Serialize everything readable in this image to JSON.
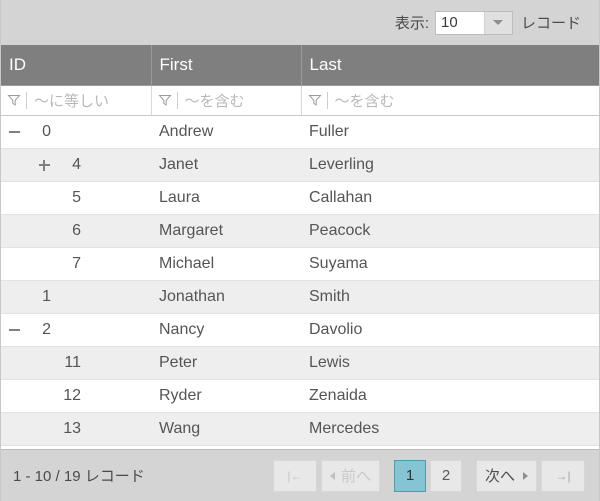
{
  "toolbar": {
    "label_prefix": "表示:",
    "page_size_value": "10",
    "label_suffix": "レコード",
    "dropdown_icon": "chevron-down-icon"
  },
  "table": {
    "columns": [
      {
        "key": "id",
        "label": "ID",
        "filter_placeholder": "〜に等しい",
        "filter_icon": "filter-funnel-icon"
      },
      {
        "key": "first",
        "label": "First",
        "filter_placeholder": "〜を含む",
        "filter_icon": "filter-funnel-icon"
      },
      {
        "key": "last",
        "label": "Last",
        "filter_placeholder": "〜を含む",
        "filter_icon": "filter-funnel-icon"
      }
    ],
    "rows": [
      {
        "id": "0",
        "first": "Andrew",
        "last": "Fuller",
        "level": 0,
        "toggle": "minus"
      },
      {
        "id": "4",
        "first": "Janet",
        "last": "Leverling",
        "level": 1,
        "toggle": "plus"
      },
      {
        "id": "5",
        "first": "Laura",
        "last": "Callahan",
        "level": 1,
        "toggle": "none"
      },
      {
        "id": "6",
        "first": "Margaret",
        "last": "Peacock",
        "level": 1,
        "toggle": "none"
      },
      {
        "id": "7",
        "first": "Michael",
        "last": "Suyama",
        "level": 1,
        "toggle": "none"
      },
      {
        "id": "1",
        "first": "Jonathan",
        "last": "Smith",
        "level": 0,
        "toggle": "none"
      },
      {
        "id": "2",
        "first": "Nancy",
        "last": "Davolio",
        "level": 0,
        "toggle": "minus"
      },
      {
        "id": "11",
        "first": "Peter",
        "last": "Lewis",
        "level": 1,
        "toggle": "none"
      },
      {
        "id": "12",
        "first": "Ryder",
        "last": "Zenaida",
        "level": 1,
        "toggle": "none"
      },
      {
        "id": "13",
        "first": "Wang",
        "last": "Mercedes",
        "level": 1,
        "toggle": "none"
      }
    ]
  },
  "pager": {
    "info": "1 - 10 / 19 レコード",
    "first_label": "|←",
    "prev_label": "前へ",
    "next_label": "次へ",
    "last_label": "→|",
    "pages": [
      "1",
      "2"
    ],
    "active_page": "1"
  },
  "colors": {
    "chrome": "#d4d4d4",
    "header_bg": "#7f7f7f",
    "alt_row": "#eeeeee",
    "active_page_bg": "#85c4d3",
    "active_page_border": "#4d9eb3",
    "text": "#555555",
    "placeholder": "#b9b9b9"
  }
}
